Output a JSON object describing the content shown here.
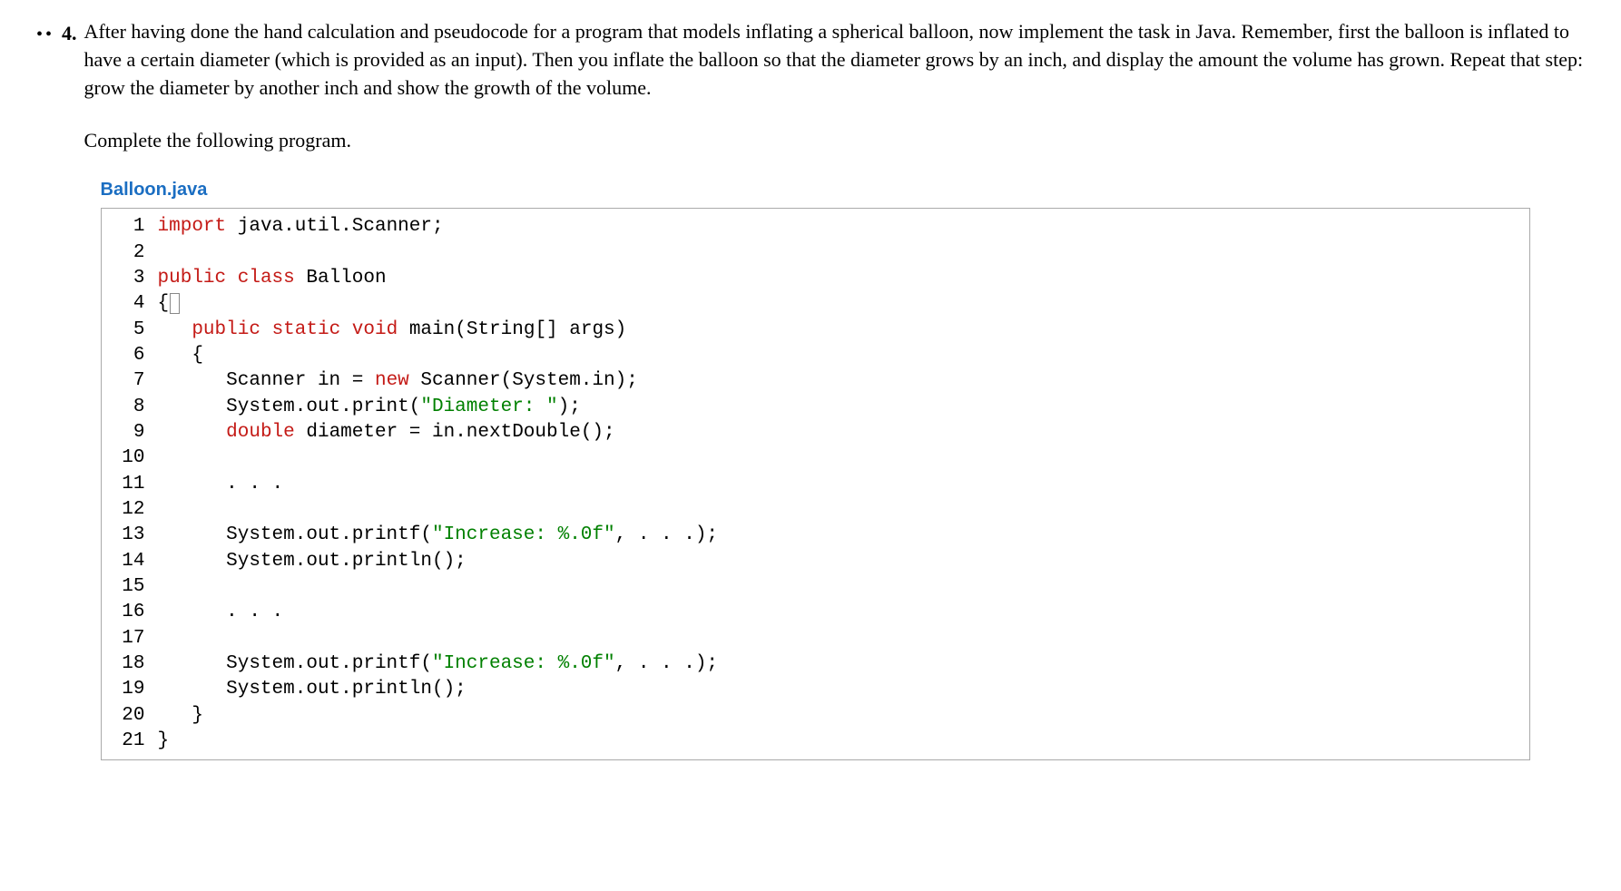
{
  "question": {
    "bullets": "••",
    "number": "4.",
    "text": "After having done the hand calculation and pseudocode for a program that models inflating a spherical balloon, now implement the task in Java. Remember, first the balloon is inflated to have a certain diameter (which is provided as an input). Then you inflate the balloon so that the diameter grows by an inch, and display the amount the volume has grown. Repeat that step: grow the diameter by another inch and show the growth of the volume.",
    "instruction": "Complete the following program."
  },
  "filename": "Balloon.java",
  "code": {
    "lines": [
      {
        "n": "1",
        "tokens": [
          {
            "t": "import",
            "cls": "kw-import"
          },
          {
            "t": " java.util.Scanner;",
            "cls": ""
          }
        ]
      },
      {
        "n": "2",
        "tokens": []
      },
      {
        "n": "3",
        "tokens": [
          {
            "t": "public",
            "cls": "kw-public"
          },
          {
            "t": " ",
            "cls": ""
          },
          {
            "t": "class",
            "cls": "kw-class"
          },
          {
            "t": " Balloon",
            "cls": ""
          }
        ]
      },
      {
        "n": "4",
        "tokens": [
          {
            "t": "{",
            "cls": ""
          }
        ],
        "cursor": true
      },
      {
        "n": "5",
        "tokens": [
          {
            "t": "   ",
            "cls": ""
          },
          {
            "t": "public",
            "cls": "kw-public"
          },
          {
            "t": " ",
            "cls": ""
          },
          {
            "t": "static",
            "cls": "kw-static"
          },
          {
            "t": " ",
            "cls": ""
          },
          {
            "t": "void",
            "cls": "kw-void"
          },
          {
            "t": " main(String[] args)",
            "cls": ""
          }
        ]
      },
      {
        "n": "6",
        "tokens": [
          {
            "t": "   {",
            "cls": ""
          }
        ]
      },
      {
        "n": "7",
        "tokens": [
          {
            "t": "      Scanner in = ",
            "cls": ""
          },
          {
            "t": "new",
            "cls": "kw-new"
          },
          {
            "t": " Scanner(System.in);",
            "cls": ""
          }
        ]
      },
      {
        "n": "8",
        "tokens": [
          {
            "t": "      System.out.print(",
            "cls": ""
          },
          {
            "t": "\"Diameter: \"",
            "cls": "string"
          },
          {
            "t": ");",
            "cls": ""
          }
        ]
      },
      {
        "n": "9",
        "tokens": [
          {
            "t": "      ",
            "cls": ""
          },
          {
            "t": "double",
            "cls": "kw-type"
          },
          {
            "t": " diameter = in.nextDouble();",
            "cls": ""
          }
        ]
      },
      {
        "n": "10",
        "tokens": []
      },
      {
        "n": "11",
        "tokens": [
          {
            "t": "      . . .",
            "cls": ""
          }
        ]
      },
      {
        "n": "12",
        "tokens": []
      },
      {
        "n": "13",
        "tokens": [
          {
            "t": "      System.out.printf(",
            "cls": ""
          },
          {
            "t": "\"Increase: %.0f\"",
            "cls": "string"
          },
          {
            "t": ", . . .);",
            "cls": ""
          }
        ]
      },
      {
        "n": "14",
        "tokens": [
          {
            "t": "      System.out.println();",
            "cls": ""
          }
        ]
      },
      {
        "n": "15",
        "tokens": []
      },
      {
        "n": "16",
        "tokens": [
          {
            "t": "      . . .",
            "cls": ""
          }
        ]
      },
      {
        "n": "17",
        "tokens": []
      },
      {
        "n": "18",
        "tokens": [
          {
            "t": "      System.out.printf(",
            "cls": ""
          },
          {
            "t": "\"Increase: %.0f\"",
            "cls": "string"
          },
          {
            "t": ", . . .);",
            "cls": ""
          }
        ]
      },
      {
        "n": "19",
        "tokens": [
          {
            "t": "      System.out.println();",
            "cls": ""
          }
        ]
      },
      {
        "n": "20",
        "tokens": [
          {
            "t": "   }",
            "cls": ""
          }
        ]
      },
      {
        "n": "21",
        "tokens": [
          {
            "t": "}",
            "cls": ""
          }
        ]
      }
    ]
  }
}
